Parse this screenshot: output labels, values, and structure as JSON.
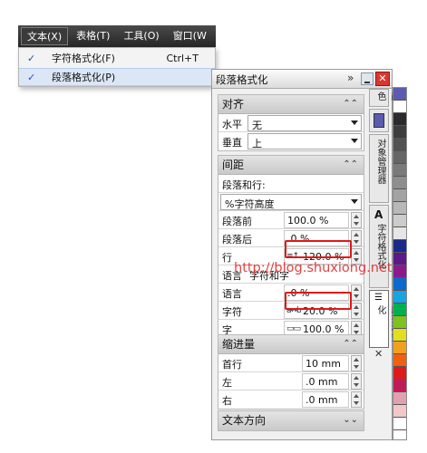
{
  "menubar": {
    "items": [
      {
        "label": "文本(X)"
      },
      {
        "label": "表格(T)"
      },
      {
        "label": "工具(O)"
      },
      {
        "label": "窗口(W"
      }
    ]
  },
  "text_menu": {
    "items": [
      {
        "label": "字符格式化(F)",
        "shortcut": "Ctrl+T",
        "checked": "✓"
      },
      {
        "label": "段落格式化(P)",
        "shortcut": "",
        "checked": "✓"
      }
    ]
  },
  "panel": {
    "title": "段落格式化",
    "header_chevron": "»",
    "close_label": "✕",
    "align": {
      "title": "对齐",
      "collapse": "⌃⌃",
      "horizontal_label": "水平",
      "horizontal_value": "无",
      "vertical_label": "垂直",
      "vertical_value": "上"
    },
    "spacing": {
      "title": "间距",
      "collapse": "⌃⌃",
      "para_line_label": "段落和行:",
      "unit_value": "%字符高度",
      "before_label": "段落前",
      "before_value": "100.0 %",
      "after_label": "段落后",
      "after_value": ".0 %",
      "line_label": "行",
      "line_value": "120.0 %",
      "lang_header_label": "语言",
      "lang_header_sub": "字符和字",
      "lang_label": "语言",
      "lang_value": ".0 %",
      "char_label": "字符",
      "char_value": "20.0 %",
      "word_label": "字",
      "word_value": "100.0 %"
    },
    "indent": {
      "title": "缩进量",
      "collapse": "⌃⌃",
      "first_label": "首行",
      "first_value": "10 mm",
      "left_label": "左",
      "left_value": ".0 mm",
      "right_label": "右",
      "right_value": ".0 mm"
    },
    "direction": {
      "title": "文本方向",
      "collapse": "⌄⌄"
    }
  },
  "side_tabs": [
    {
      "label": "颜色"
    },
    {
      "label": "对象管理器"
    },
    {
      "label": "字符格式化"
    },
    {
      "label": "段落格式化"
    }
  ],
  "side_close": "✕",
  "palette": [
    "#5b5bb0",
    "#ffffff",
    "#2b2b2b",
    "#3d3d3d",
    "#525252",
    "#666666",
    "#7a7a7a",
    "#8e8e8e",
    "#a3a3a3",
    "#b8b8b8",
    "#cccccc",
    "#e6e6e6",
    "#1a2a8a",
    "#5a1a8a",
    "#8a1a8a",
    "#0a6ad0",
    "#18a4e0",
    "#00b050",
    "#80c020",
    "#e0e020",
    "#f0a020",
    "#f06010",
    "#e01a1a",
    "#c01a5a",
    "#e0a0b0",
    "#f0c8c8",
    "#ffffff"
  ],
  "watermark": "http://blog.shuxiong.net"
}
